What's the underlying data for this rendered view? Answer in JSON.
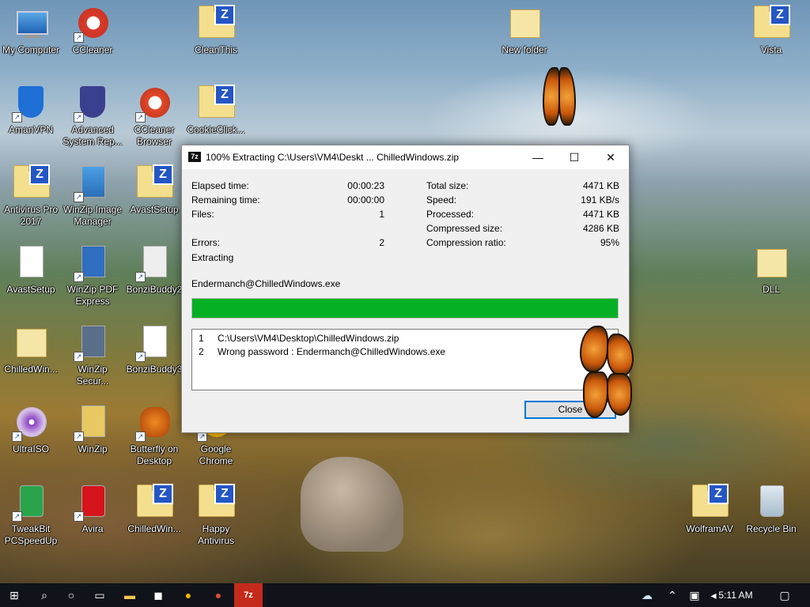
{
  "desktop": {
    "icons": [
      {
        "label": "My Computer"
      },
      {
        "label": "CCleaner"
      },
      {
        "label": "CleanThis"
      },
      {
        "label": "New folder"
      },
      {
        "label": "Vista"
      },
      {
        "label": "AmanVPN"
      },
      {
        "label": "Advanced System Rep..."
      },
      {
        "label": "CCleaner Browser"
      },
      {
        "label": "CookieClick..."
      },
      {
        "label": "Antivirus Pro 2017"
      },
      {
        "label": "WinZip Image Manager"
      },
      {
        "label": "AvastSetup"
      },
      {
        "label": "DLL"
      },
      {
        "label": "AvastSetup"
      },
      {
        "label": "WinZip PDF Express"
      },
      {
        "label": "BonziBuddy2"
      },
      {
        "label": "ChilledWin..."
      },
      {
        "label": "WinZip Secur..."
      },
      {
        "label": "BonziBuddy3"
      },
      {
        "label": "UltraISO"
      },
      {
        "label": "WinZip"
      },
      {
        "label": "Butterfly on Desktop"
      },
      {
        "label": "Google Chrome"
      },
      {
        "label": "TweakBit PCSpeedUp"
      },
      {
        "label": "Avira"
      },
      {
        "label": "ChilledWin..."
      },
      {
        "label": "Happy Antivirus"
      },
      {
        "label": "WolframAV"
      },
      {
        "label": "Recycle Bin"
      }
    ]
  },
  "dialog": {
    "title": "100% Extracting C:\\Users\\VM4\\Deskt ... ChilledWindows.zip",
    "app_icon_text": "7z",
    "minimize": "—",
    "maximize": "☐",
    "close": "✕",
    "left_stats": [
      {
        "label": "Elapsed time:",
        "value": "00:00:23"
      },
      {
        "label": "Remaining time:",
        "value": "00:00:00"
      },
      {
        "label": "Files:",
        "value": "1"
      },
      {
        "label": "Errors:",
        "value": "2"
      }
    ],
    "right_stats": [
      {
        "label": "Total size:",
        "value": "4471 KB"
      },
      {
        "label": "Speed:",
        "value": "191 KB/s"
      },
      {
        "label": "Processed:",
        "value": "4471 KB"
      },
      {
        "label": "Compressed size:",
        "value": "4286 KB"
      },
      {
        "label": "Compression ratio:",
        "value": "95%"
      }
    ],
    "status": "Extracting",
    "current_file": "Endermanch@ChilledWindows.exe",
    "progress_percent": 100,
    "progress_color": "#06b025",
    "log": [
      {
        "num": "1",
        "text": "C:\\Users\\VM4\\Desktop\\ChilledWindows.zip"
      },
      {
        "num": "2",
        "text": "Wrong password : Endermanch@ChilledWindows.exe"
      }
    ],
    "close_button": "Close"
  },
  "taskbar": {
    "start_icon": "windows-start-icon",
    "search_icon": "search-icon",
    "cortana_icon": "cortana-icon",
    "taskview_icon": "task-view-icon",
    "time": "5:11 AM"
  }
}
